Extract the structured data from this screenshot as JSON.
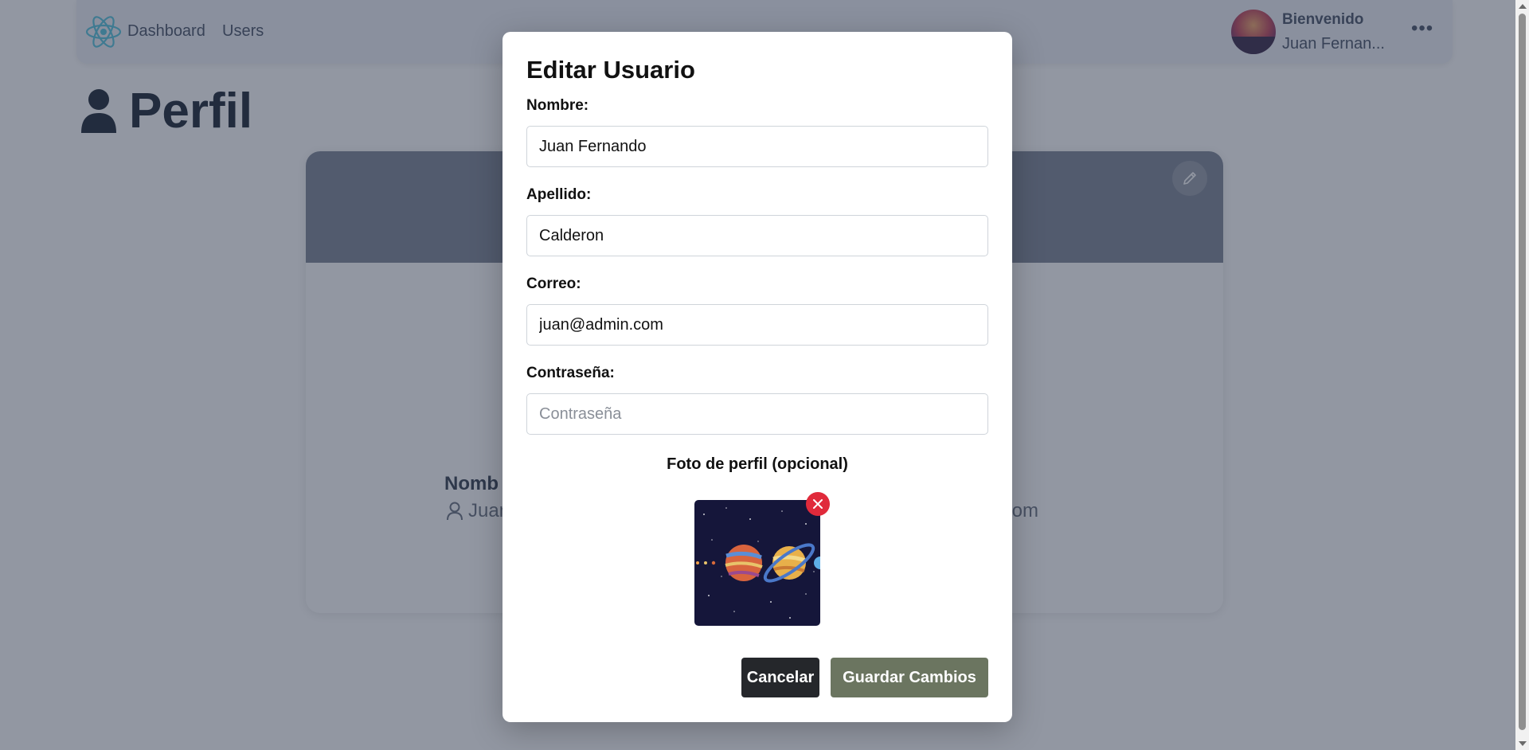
{
  "navbar": {
    "links": [
      "Dashboard",
      "Users"
    ],
    "welcome": "Bienvenido",
    "user_name": "Juan Fernan..."
  },
  "page": {
    "title": "Perfil"
  },
  "profile_card": {
    "name_label": "Nomb",
    "name_value": "Juan",
    "email_value": "min.Com"
  },
  "modal": {
    "title": "Editar Usuario",
    "fields": {
      "nombre": {
        "label": "Nombre:",
        "value": "Juan Fernando"
      },
      "apellido": {
        "label": "Apellido:",
        "value": "Calderon"
      },
      "correo": {
        "label": "Correo:",
        "value": "juan@admin.com"
      },
      "contrasena": {
        "label": "Contraseña:",
        "value": "",
        "placeholder": "Contraseña"
      }
    },
    "photo_label": "Foto de perfil (opcional)",
    "buttons": {
      "cancel": "Cancelar",
      "save": "Guardar Cambios"
    }
  },
  "icons": {
    "logo": "react-atom-icon",
    "title": "user-icon",
    "edit": "pencil-icon",
    "remove_photo": "close-icon",
    "more": "ellipsis-icon"
  },
  "colors": {
    "overlay": "#252f46",
    "cancel_button": "#25272b",
    "save_button": "#6b7560",
    "remove_badge": "#e02a3b",
    "logo": "#58c4dc"
  }
}
